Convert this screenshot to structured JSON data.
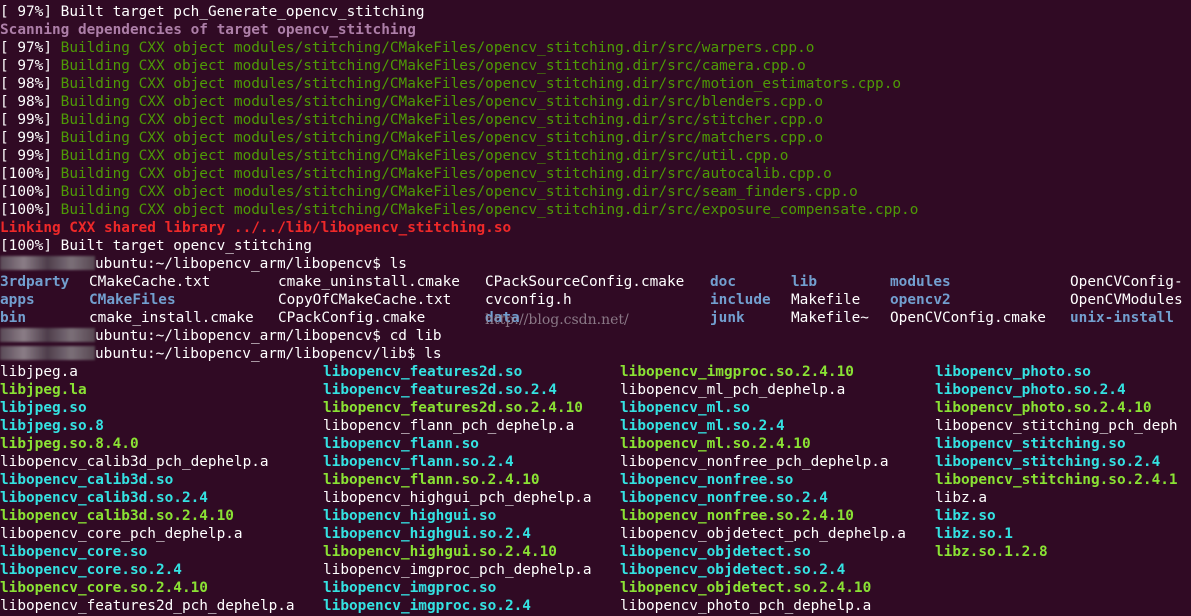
{
  "window": {
    "background": "#300a24"
  },
  "colors": {
    "plain": "#ffffff",
    "progress": "#4e9a06",
    "scan": "#ad7fa8",
    "link": "#ef2929",
    "dir": "#729fcf",
    "symlink": "#34e2e2",
    "executable": "#8ae234"
  },
  "build_lines": [
    {
      "prefix": "[ 97%] ",
      "text": "Built target pch_Generate_opencv_stitching",
      "style": "w"
    },
    {
      "prefix": "",
      "text": "Scanning dependencies of target opencv_stitching",
      "style": "m"
    },
    {
      "prefix": "[ 97%] ",
      "text": "Building CXX object modules/stitching/CMakeFiles/opencv_stitching.dir/src/warpers.cpp.o",
      "style": "g"
    },
    {
      "prefix": "[ 97%] ",
      "text": "Building CXX object modules/stitching/CMakeFiles/opencv_stitching.dir/src/camera.cpp.o",
      "style": "g"
    },
    {
      "prefix": "[ 98%] ",
      "text": "Building CXX object modules/stitching/CMakeFiles/opencv_stitching.dir/src/motion_estimators.cpp.o",
      "style": "g"
    },
    {
      "prefix": "[ 98%] ",
      "text": "Building CXX object modules/stitching/CMakeFiles/opencv_stitching.dir/src/blenders.cpp.o",
      "style": "g"
    },
    {
      "prefix": "[ 99%] ",
      "text": "Building CXX object modules/stitching/CMakeFiles/opencv_stitching.dir/src/stitcher.cpp.o",
      "style": "g"
    },
    {
      "prefix": "[ 99%] ",
      "text": "Building CXX object modules/stitching/CMakeFiles/opencv_stitching.dir/src/matchers.cpp.o",
      "style": "g"
    },
    {
      "prefix": "[ 99%] ",
      "text": "Building CXX object modules/stitching/CMakeFiles/opencv_stitching.dir/src/util.cpp.o",
      "style": "g"
    },
    {
      "prefix": "[100%] ",
      "text": "Building CXX object modules/stitching/CMakeFiles/opencv_stitching.dir/src/autocalib.cpp.o",
      "style": "g"
    },
    {
      "prefix": "[100%] ",
      "text": "Building CXX object modules/stitching/CMakeFiles/opencv_stitching.dir/src/seam_finders.cpp.o",
      "style": "g"
    },
    {
      "prefix": "[100%] ",
      "text": "Building CXX object modules/stitching/CMakeFiles/opencv_stitching.dir/src/exposure_compensate.cpp.o",
      "style": "g"
    },
    {
      "prefix": "",
      "text": "Linking CXX shared library ../../lib/libopencv_stitching.so",
      "style": "r"
    },
    {
      "prefix": "[100%] ",
      "text": "Built target opencv_stitching",
      "style": "w"
    }
  ],
  "prompts": [
    {
      "path": "ubuntu:~/libopencv_arm/libopencv$ ",
      "cmd": "ls"
    },
    {
      "path": "ubuntu:~/libopencv_arm/libopencv$ ",
      "cmd": "cd lib"
    },
    {
      "path": "ubuntu:~/libopencv_arm/libopencv/lib$ ",
      "cmd": "ls"
    }
  ],
  "ls1": [
    [
      {
        "t": "3rdparty",
        "s": "b"
      },
      {
        "t": "CMakeCache.txt",
        "s": "w"
      },
      {
        "t": "cmake_uninstall.cmake",
        "s": "w"
      },
      {
        "t": "CPackSourceConfig.cmake",
        "s": "w"
      },
      {
        "t": "doc",
        "s": "b"
      },
      {
        "t": "lib",
        "s": "b"
      },
      {
        "t": "modules",
        "s": "b"
      },
      {
        "t": "OpenCVConfig-",
        "s": "w"
      }
    ],
    [
      {
        "t": "apps",
        "s": "b"
      },
      {
        "t": "CMakeFiles",
        "s": "b"
      },
      {
        "t": "CopyOfCMakeCache.txt",
        "s": "w"
      },
      {
        "t": "cvconfig.h",
        "s": "w"
      },
      {
        "t": "include",
        "s": "b"
      },
      {
        "t": "Makefile",
        "s": "w"
      },
      {
        "t": "opencv2",
        "s": "b"
      },
      {
        "t": "OpenCVModules",
        "s": "w"
      }
    ],
    [
      {
        "t": "bin",
        "s": "b"
      },
      {
        "t": "cmake_install.cmake",
        "s": "w"
      },
      {
        "t": "CPackConfig.cmake",
        "s": "w"
      },
      {
        "t": "data",
        "s": "b"
      },
      {
        "t": "junk",
        "s": "b"
      },
      {
        "t": "Makefile~",
        "s": "w"
      },
      {
        "t": "OpenCVConfig.cmake",
        "s": "w"
      },
      {
        "t": "unix-install",
        "s": "b"
      }
    ]
  ],
  "ls2": [
    [
      {
        "t": "libjpeg.a",
        "s": "w"
      },
      {
        "t": "libopencv_features2d.so",
        "s": "c"
      },
      {
        "t": "libopencv_imgproc.so.2.4.10",
        "s": "lg"
      },
      {
        "t": "libopencv_photo.so",
        "s": "c"
      }
    ],
    [
      {
        "t": "libjpeg.la",
        "s": "lg"
      },
      {
        "t": "libopencv_features2d.so.2.4",
        "s": "c"
      },
      {
        "t": "libopencv_ml_pch_dephelp.a",
        "s": "w"
      },
      {
        "t": "libopencv_photo.so.2.4",
        "s": "c"
      }
    ],
    [
      {
        "t": "libjpeg.so",
        "s": "c"
      },
      {
        "t": "libopencv_features2d.so.2.4.10",
        "s": "lg"
      },
      {
        "t": "libopencv_ml.so",
        "s": "c"
      },
      {
        "t": "libopencv_photo.so.2.4.10",
        "s": "lg"
      }
    ],
    [
      {
        "t": "libjpeg.so.8",
        "s": "c"
      },
      {
        "t": "libopencv_flann_pch_dephelp.a",
        "s": "w"
      },
      {
        "t": "libopencv_ml.so.2.4",
        "s": "c"
      },
      {
        "t": "libopencv_stitching_pch_deph",
        "s": "w"
      }
    ],
    [
      {
        "t": "libjpeg.so.8.4.0",
        "s": "lg"
      },
      {
        "t": "libopencv_flann.so",
        "s": "c"
      },
      {
        "t": "libopencv_ml.so.2.4.10",
        "s": "lg"
      },
      {
        "t": "libopencv_stitching.so",
        "s": "c"
      }
    ],
    [
      {
        "t": "libopencv_calib3d_pch_dephelp.a",
        "s": "w"
      },
      {
        "t": "libopencv_flann.so.2.4",
        "s": "c"
      },
      {
        "t": "libopencv_nonfree_pch_dephelp.a",
        "s": "w"
      },
      {
        "t": "libopencv_stitching.so.2.4",
        "s": "c"
      }
    ],
    [
      {
        "t": "libopencv_calib3d.so",
        "s": "c"
      },
      {
        "t": "libopencv_flann.so.2.4.10",
        "s": "lg"
      },
      {
        "t": "libopencv_nonfree.so",
        "s": "c"
      },
      {
        "t": "libopencv_stitching.so.2.4.1",
        "s": "lg"
      }
    ],
    [
      {
        "t": "libopencv_calib3d.so.2.4",
        "s": "c"
      },
      {
        "t": "libopencv_highgui_pch_dephelp.a",
        "s": "w"
      },
      {
        "t": "libopencv_nonfree.so.2.4",
        "s": "c"
      },
      {
        "t": "libz.a",
        "s": "w"
      }
    ],
    [
      {
        "t": "libopencv_calib3d.so.2.4.10",
        "s": "lg"
      },
      {
        "t": "libopencv_highgui.so",
        "s": "c"
      },
      {
        "t": "libopencv_nonfree.so.2.4.10",
        "s": "lg"
      },
      {
        "t": "libz.so",
        "s": "c"
      }
    ],
    [
      {
        "t": "libopencv_core_pch_dephelp.a",
        "s": "w"
      },
      {
        "t": "libopencv_highgui.so.2.4",
        "s": "c"
      },
      {
        "t": "libopencv_objdetect_pch_dephelp.a",
        "s": "w"
      },
      {
        "t": "libz.so.1",
        "s": "c"
      }
    ],
    [
      {
        "t": "libopencv_core.so",
        "s": "c"
      },
      {
        "t": "libopencv_highgui.so.2.4.10",
        "s": "lg"
      },
      {
        "t": "libopencv_objdetect.so",
        "s": "c"
      },
      {
        "t": "libz.so.1.2.8",
        "s": "lg"
      }
    ],
    [
      {
        "t": "libopencv_core.so.2.4",
        "s": "c"
      },
      {
        "t": "libopencv_imgproc_pch_dephelp.a",
        "s": "w"
      },
      {
        "t": "libopencv_objdetect.so.2.4",
        "s": "c"
      },
      {
        "t": "",
        "s": "w"
      }
    ],
    [
      {
        "t": "libopencv_core.so.2.4.10",
        "s": "lg"
      },
      {
        "t": "libopencv_imgproc.so",
        "s": "c"
      },
      {
        "t": "libopencv_objdetect.so.2.4.10",
        "s": "lg"
      },
      {
        "t": "",
        "s": "w"
      }
    ],
    [
      {
        "t": "libopencv_features2d_pch_dephelp.a",
        "s": "w"
      },
      {
        "t": "libopencv_imgproc.so.2.4",
        "s": "c"
      },
      {
        "t": "libopencv_photo_pch_dephelp.a",
        "s": "w"
      },
      {
        "t": "",
        "s": "w"
      }
    ]
  ],
  "watermark": "http://blog.csdn.net/"
}
